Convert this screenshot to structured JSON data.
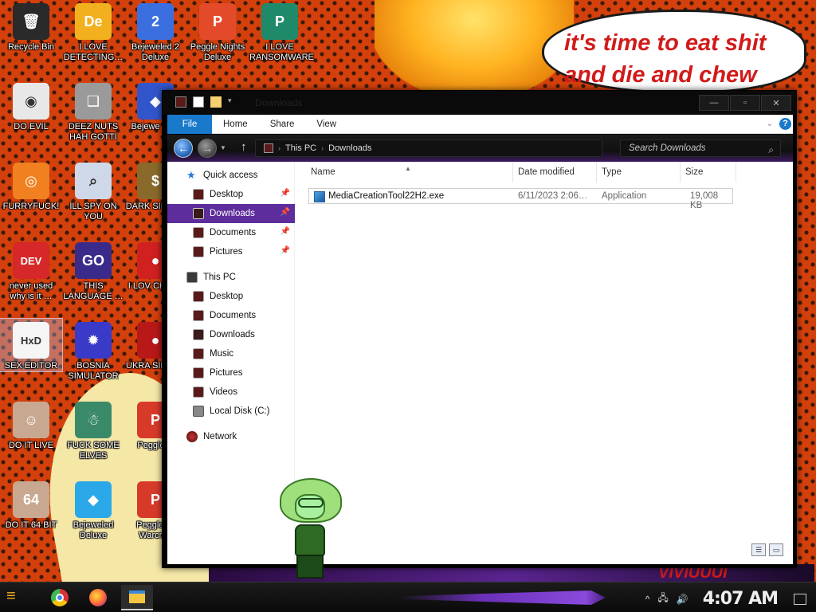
{
  "wallpaper": {
    "speech_text": "it's time to eat shit and die and chew",
    "bottom_text": "VIVIUUUI"
  },
  "desktop_icons": [
    {
      "label": "Recycle Bin",
      "glyph": "🗑",
      "bg": "#2a2a2a",
      "icon": "recycle-bin-icon"
    },
    {
      "label": "I LOVE DETECTING…",
      "glyph": "De",
      "bg": "#f2b01e",
      "icon": "de-app-icon"
    },
    {
      "label": "Bejeweled 2 Deluxe",
      "glyph": "2",
      "bg": "#3b6fe0",
      "icon": "bejeweled2-icon"
    },
    {
      "label": "Peggle Nights Deluxe",
      "glyph": "P",
      "bg": "#e34a2a",
      "icon": "peggle-nights-icon"
    },
    {
      "label": "I LOVE RANSOMWARE",
      "glyph": "P",
      "bg": "#1f8a6a",
      "icon": "publisher-icon"
    },
    {
      "label": "DO EVIL",
      "glyph": "◉",
      "bg": "#e8e8e8",
      "icon": "chrome-icon"
    },
    {
      "label": "DEEZ NUTS HAH GOTTI",
      "glyph": "❏",
      "bg": "#9a9a9a",
      "icon": "stacked-windows-icon"
    },
    {
      "label": "Bejewe Twis",
      "glyph": "◆",
      "bg": "#3355cc",
      "icon": "bejeweled-twist-icon"
    },
    {
      "label": "FURRYFUCK!",
      "glyph": "◎",
      "bg": "#f08020",
      "icon": "firefox-icon"
    },
    {
      "label": "ILL SPY ON YOU",
      "glyph": "⌕",
      "bg": "#cfd8e8",
      "icon": "spy-icon"
    },
    {
      "label": "DARK SIMULA",
      "glyph": "$",
      "bg": "#8a6a2a",
      "icon": "money-bag-icon"
    },
    {
      "label": "never used why is it …",
      "glyph": "DEV",
      "bg": "#d62828",
      "icon": "devcpp-icon"
    },
    {
      "label": "THIS LANGUAGE …",
      "glyph": "GO",
      "bg": "#3a2a8a",
      "icon": "goland-icon"
    },
    {
      "label": "I LOV CHUZZ",
      "glyph": "●",
      "bg": "#d02020",
      "icon": "chuzzle-icon"
    },
    {
      "label": "SEX EDITOR",
      "glyph": "HxD",
      "bg": "#f5f5f5",
      "icon": "hxd-icon"
    },
    {
      "label": "BOSNIA SIMULATOR",
      "glyph": "✹",
      "bg": "#3a3ac8",
      "icon": "mine-icon"
    },
    {
      "label": "UKRA SIMULA",
      "glyph": "●",
      "bg": "#b81818",
      "icon": "ukraine-sim-icon"
    },
    {
      "label": "DO IT LIVE",
      "glyph": "☺",
      "bg": "#c8a890",
      "icon": "portrait-icon"
    },
    {
      "label": "FUCK SOME ELVES",
      "glyph": "☃",
      "bg": "#3a8a6a",
      "icon": "elves-icon"
    },
    {
      "label": "Peggle D",
      "glyph": "P",
      "bg": "#d83a2a",
      "icon": "peggle-deluxe-icon"
    },
    {
      "label": "DO IT 64 BIT",
      "glyph": "64",
      "bg": "#c8a890",
      "icon": "portrait-64-icon"
    },
    {
      "label": "Bejeweled Deluxe",
      "glyph": "◆",
      "bg": "#2aa8e8",
      "icon": "bejeweled-deluxe-icon"
    },
    {
      "label": "Peggle W Warcraft",
      "glyph": "P",
      "bg": "#d83a2a",
      "icon": "peggle-wow-icon"
    }
  ],
  "window": {
    "title": "Downloads",
    "ribbon_tabs": [
      "File",
      "Home",
      "Share",
      "View"
    ],
    "breadcrumb": [
      "This PC",
      "Downloads"
    ],
    "search_placeholder": "Search Downloads",
    "nav": {
      "quick_access": "Quick access",
      "quick_items": [
        "Desktop",
        "Downloads",
        "Documents",
        "Pictures"
      ],
      "this_pc": "This PC",
      "pc_items": [
        "Desktop",
        "Documents",
        "Downloads",
        "Music",
        "Pictures",
        "Videos",
        "Local Disk (C:)"
      ],
      "network": "Network"
    },
    "columns": [
      "Name",
      "Date modified",
      "Type",
      "Size"
    ],
    "files": [
      {
        "name": "MediaCreationTool22H2.exe",
        "date": "6/11/2023 2:06…",
        "type": "Application",
        "size": "19,008 KB"
      }
    ]
  },
  "taskbar": {
    "clock": "4:07 AM",
    "apps": [
      "chrome-icon",
      "firefox-icon",
      "file-explorer-icon"
    ]
  },
  "colors": {
    "accent_blue": "#1979ca",
    "nav_selected": "#5d2d9c",
    "wallpaper_orange": "#d4400c"
  }
}
